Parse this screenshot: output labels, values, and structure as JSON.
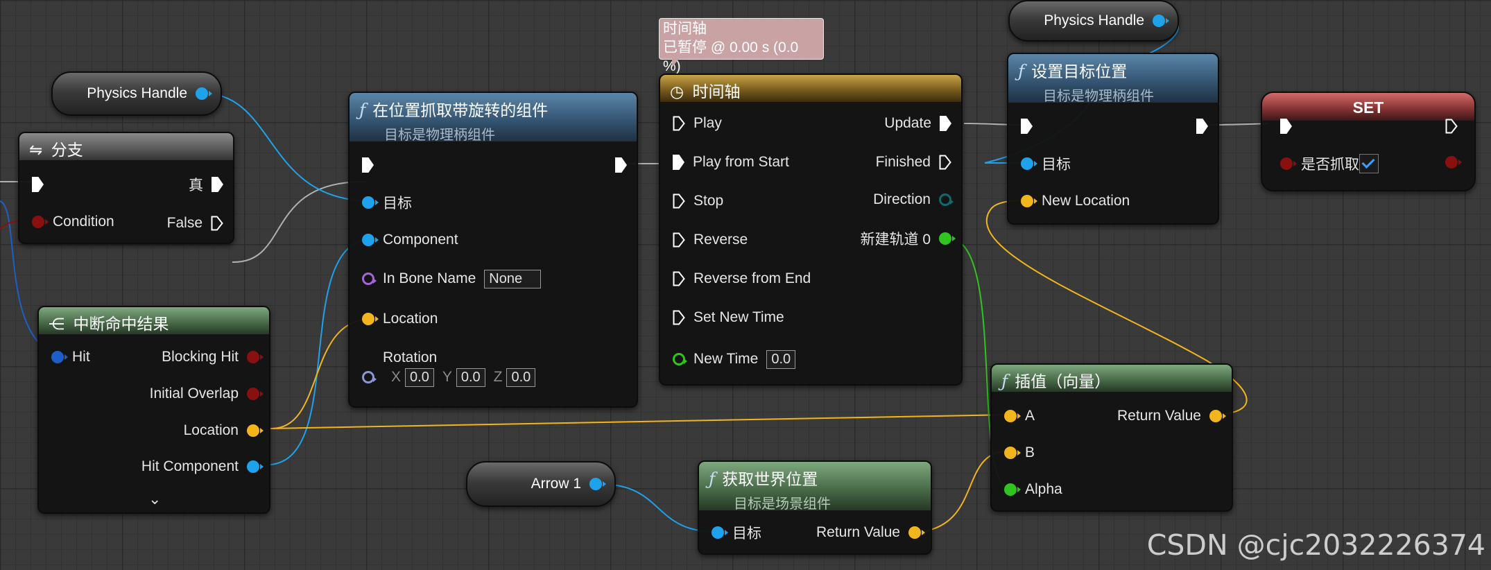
{
  "tooltip": {
    "line1": "时间轴",
    "line2": "已暂停 @ 0.00 s (0.0 %)"
  },
  "vars": {
    "physics_handle_a": "Physics Handle",
    "physics_handle_b": "Physics Handle",
    "arrow": "Arrow 1"
  },
  "branch": {
    "title": "分支",
    "true_label": "真",
    "condition": "Condition",
    "false_label": "False"
  },
  "break_hit": {
    "title": "中断命中结果",
    "hit": "Hit",
    "blocking_hit": "Blocking Hit",
    "initial_overlap": "Initial Overlap",
    "location": "Location",
    "hit_component": "Hit Component"
  },
  "grab": {
    "title": "在位置抓取带旋转的组件",
    "subtitle": "目标是物理柄组件",
    "target": "目标",
    "component": "Component",
    "bone_name": "In Bone Name",
    "bone_value": "None",
    "location": "Location",
    "rotation": "Rotation",
    "x": "X",
    "x_val": "0.0",
    "y": "Y",
    "y_val": "0.0",
    "z": "Z",
    "z_val": "0.0"
  },
  "timeline": {
    "title": "时间轴",
    "play": "Play",
    "play_start": "Play from Start",
    "stop": "Stop",
    "reverse": "Reverse",
    "reverse_end": "Reverse from End",
    "set_time": "Set New Time",
    "new_time": "New Time",
    "new_time_val": "0.0",
    "update": "Update",
    "finished": "Finished",
    "direction": "Direction",
    "track": "新建轨道 0"
  },
  "set_target": {
    "title": "设置目标位置",
    "subtitle": "目标是物理柄组件",
    "target": "目标",
    "new_location": "New Location"
  },
  "set_node": {
    "title": "SET",
    "var": "是否抓取"
  },
  "lerp": {
    "title": "插值（向量）",
    "a": "A",
    "b": "B",
    "alpha": "Alpha",
    "ret": "Return Value"
  },
  "world_loc": {
    "title": "获取世界位置",
    "subtitle": "目标是场景组件",
    "target": "目标",
    "ret": "Return Value"
  },
  "watermark": "CSDN @cjc2032226374",
  "colors": {
    "object": "#1ea2ec",
    "vector": "#f2b51c",
    "bool": "#8a1010",
    "float": "#2fc41e",
    "exec": "#ffffff"
  },
  "icons": {
    "function": "function-icon",
    "clock": "clock-icon",
    "branch": "branch-icon",
    "break": "break-icon",
    "chevron": "chevron-down-icon"
  }
}
